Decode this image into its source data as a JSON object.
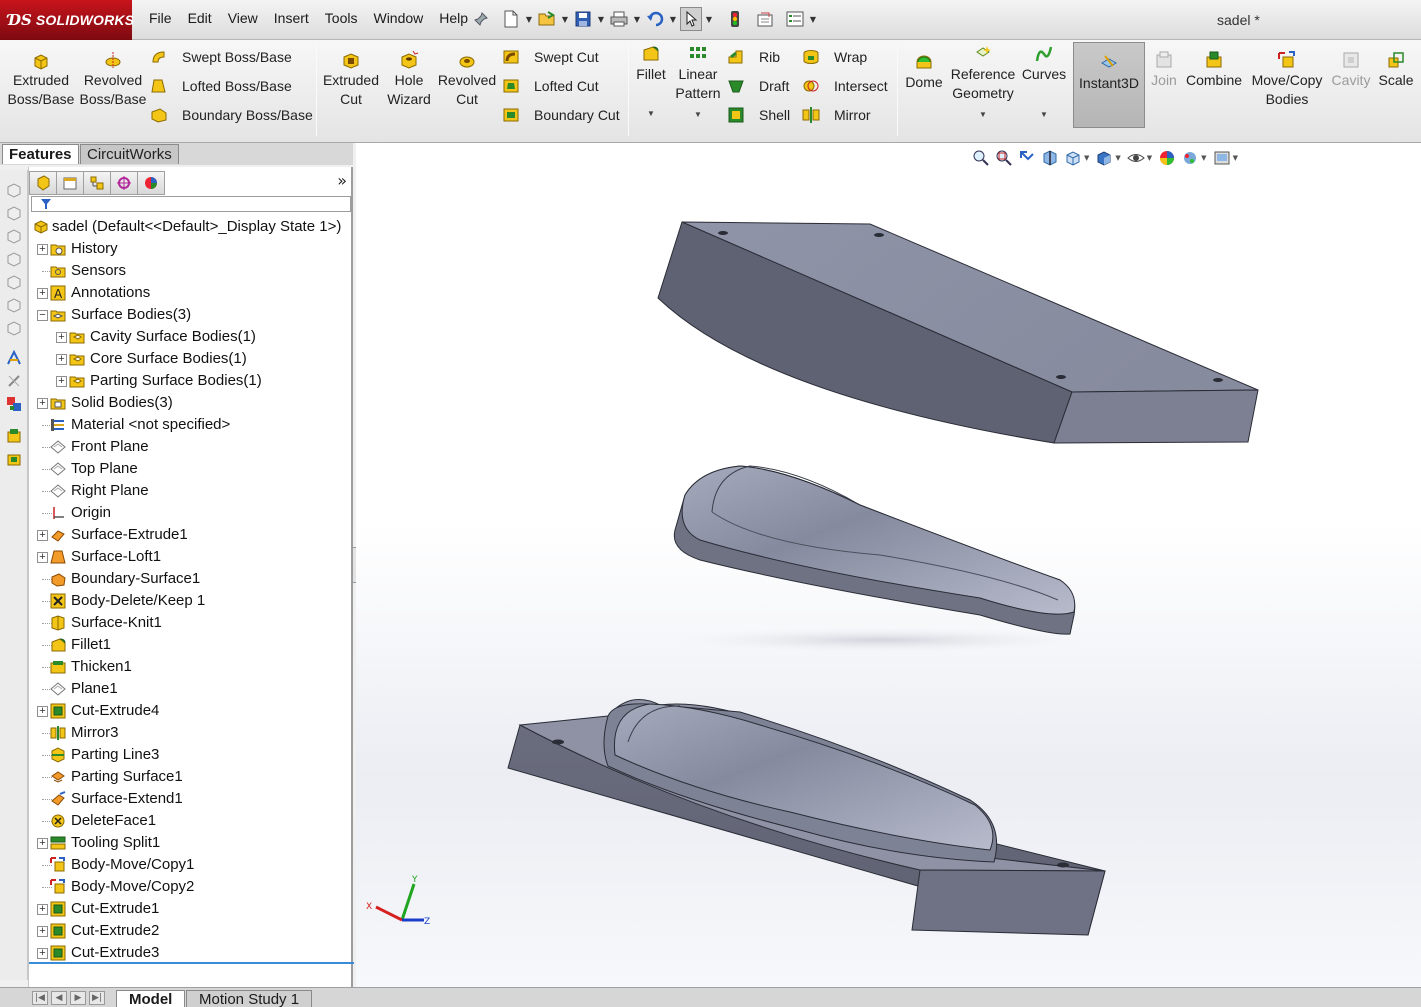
{
  "app": {
    "logo_text": "SOLIDWORKS",
    "document_title": "sadel *"
  },
  "menu": [
    "File",
    "Edit",
    "View",
    "Insert",
    "Tools",
    "Window",
    "Help"
  ],
  "quick_access": [
    "new-document-icon",
    "open-icon",
    "save-icon",
    "print-icon",
    "undo-icon",
    "select-icon",
    "rebuild-icon",
    "file-properties-icon",
    "options-icon"
  ],
  "commands": {
    "extruded_boss_1": "Extruded",
    "extruded_boss_2": "Boss/Base",
    "revolved_boss_1": "Revolved",
    "revolved_boss_2": "Boss/Base",
    "swept_boss": "Swept Boss/Base",
    "lofted_boss": "Lofted Boss/Base",
    "boundary_boss": "Boundary Boss/Base",
    "extruded_cut_1": "Extruded",
    "extruded_cut_2": "Cut",
    "hole_wizard_1": "Hole",
    "hole_wizard_2": "Wizard",
    "revolved_cut_1": "Revolved",
    "revolved_cut_2": "Cut",
    "swept_cut": "Swept Cut",
    "lofted_cut": "Lofted Cut",
    "boundary_cut": "Boundary Cut",
    "fillet": "Fillet",
    "linear_pattern_1": "Linear",
    "linear_pattern_2": "Pattern",
    "rib": "Rib",
    "draft": "Draft",
    "shell": "Shell",
    "wrap": "Wrap",
    "intersect": "Intersect",
    "mirror": "Mirror",
    "dome": "Dome",
    "reference_geometry_1": "Reference",
    "reference_geometry_2": "Geometry",
    "curves": "Curves",
    "instant3d": "Instant3D",
    "join": "Join",
    "combine": "Combine",
    "move_copy_1": "Move/Copy",
    "move_copy_2": "Bodies",
    "cavity": "Cavity",
    "scale": "Scale"
  },
  "feature_manager": {
    "tabs": [
      "Features",
      "CircuitWorks"
    ],
    "root": "sadel  (Default<<Default>_Display State 1>)",
    "items": [
      {
        "label": "History",
        "icon": "history-folder-icon",
        "expand": true,
        "indent": 0
      },
      {
        "label": "Sensors",
        "icon": "sensors-folder-icon",
        "expand": false,
        "indent": 0
      },
      {
        "label": "Annotations",
        "icon": "annotations-icon",
        "expand": true,
        "indent": 0
      },
      {
        "label": "Surface Bodies(3)",
        "icon": "surface-bodies-folder-icon",
        "expand": true,
        "indent": 0,
        "open": true
      },
      {
        "label": "Cavity Surface Bodies(1)",
        "icon": "folder-icon",
        "expand": true,
        "indent": 1
      },
      {
        "label": "Core Surface Bodies(1)",
        "icon": "folder-icon",
        "expand": true,
        "indent": 1
      },
      {
        "label": "Parting Surface Bodies(1)",
        "icon": "folder-icon",
        "expand": true,
        "indent": 1
      },
      {
        "label": "Solid Bodies(3)",
        "icon": "solid-bodies-folder-icon",
        "expand": true,
        "indent": 0
      },
      {
        "label": "Material <not specified>",
        "icon": "material-icon",
        "expand": false,
        "indent": 0
      },
      {
        "label": "Front Plane",
        "icon": "plane-icon",
        "expand": false,
        "indent": 0
      },
      {
        "label": "Top Plane",
        "icon": "plane-icon",
        "expand": false,
        "indent": 0
      },
      {
        "label": "Right Plane",
        "icon": "plane-icon",
        "expand": false,
        "indent": 0
      },
      {
        "label": "Origin",
        "icon": "origin-icon",
        "expand": false,
        "indent": 0
      },
      {
        "label": "Surface-Extrude1",
        "icon": "surface-extrude-icon",
        "expand": true,
        "indent": 0
      },
      {
        "label": "Surface-Loft1",
        "icon": "surface-loft-icon",
        "expand": true,
        "indent": 0
      },
      {
        "label": "Boundary-Surface1",
        "icon": "boundary-surface-icon",
        "expand": false,
        "indent": 0
      },
      {
        "label": "Body-Delete/Keep 1",
        "icon": "body-delete-icon",
        "expand": false,
        "indent": 0
      },
      {
        "label": "Surface-Knit1",
        "icon": "surface-knit-icon",
        "expand": false,
        "indent": 0
      },
      {
        "label": "Fillet1",
        "icon": "fillet-icon",
        "expand": false,
        "indent": 0
      },
      {
        "label": "Thicken1",
        "icon": "thicken-icon",
        "expand": false,
        "indent": 0
      },
      {
        "label": "Plane1",
        "icon": "plane-icon",
        "expand": false,
        "indent": 0
      },
      {
        "label": "Cut-Extrude4",
        "icon": "cut-extrude-icon",
        "expand": true,
        "indent": 0
      },
      {
        "label": "Mirror3",
        "icon": "mirror-icon",
        "expand": false,
        "indent": 0
      },
      {
        "label": "Parting Line3",
        "icon": "parting-line-icon",
        "expand": false,
        "indent": 0
      },
      {
        "label": "Parting Surface1",
        "icon": "parting-surface-icon",
        "expand": false,
        "indent": 0
      },
      {
        "label": "Surface-Extend1",
        "icon": "surface-extend-icon",
        "expand": false,
        "indent": 0
      },
      {
        "label": "DeleteFace1",
        "icon": "delete-face-icon",
        "expand": false,
        "indent": 0
      },
      {
        "label": "Tooling Split1",
        "icon": "tooling-split-icon",
        "expand": true,
        "indent": 0
      },
      {
        "label": "Body-Move/Copy1",
        "icon": "move-copy-icon",
        "expand": false,
        "indent": 0
      },
      {
        "label": "Body-Move/Copy2",
        "icon": "move-copy-icon",
        "expand": false,
        "indent": 0
      },
      {
        "label": "Cut-Extrude1",
        "icon": "cut-extrude-icon",
        "expand": true,
        "indent": 0
      },
      {
        "label": "Cut-Extrude2",
        "icon": "cut-extrude-icon",
        "expand": true,
        "indent": 0
      },
      {
        "label": "Cut-Extrude3",
        "icon": "cut-extrude-icon",
        "expand": true,
        "indent": 0
      }
    ]
  },
  "bottom_tabs": [
    "Model",
    "Motion Study 1"
  ],
  "triad": {
    "x": "X",
    "y": "Y",
    "z": "Z"
  },
  "colors": {
    "model_body": "#7f8294",
    "brand_red": "#b3141c",
    "accent_yellow": "#f2c200",
    "accent_green": "#2f9b2f"
  }
}
